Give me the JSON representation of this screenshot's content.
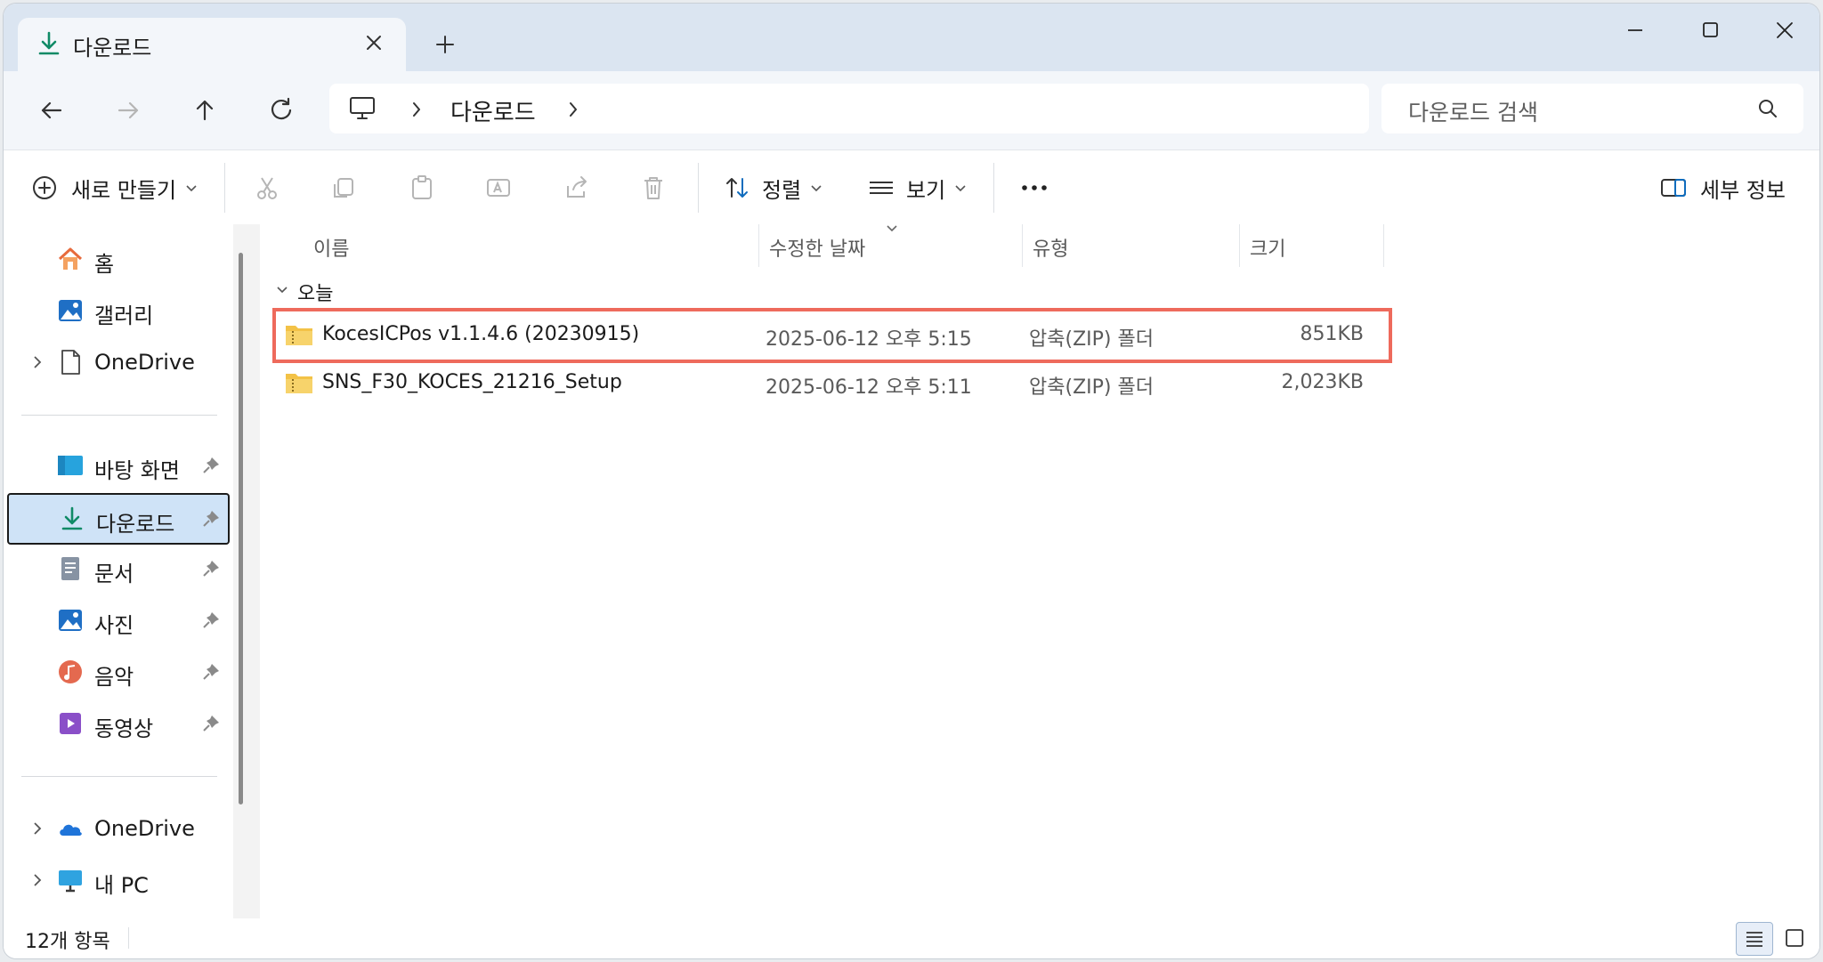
{
  "tab": {
    "title": "다운로드"
  },
  "address": {
    "segments": [
      "다운로드"
    ]
  },
  "search": {
    "placeholder": "다운로드 검색"
  },
  "command_bar": {
    "new_label": "새로 만들기",
    "sort_label": "정렬",
    "view_label": "보기",
    "details_label": "세부 정보"
  },
  "sidebar": {
    "home": "홈",
    "gallery": "갤러리",
    "onedrive_personal": "OneDrive",
    "desktop": "바탕 화면",
    "downloads": "다운로드",
    "documents": "문서",
    "pictures": "사진",
    "music": "음악",
    "videos": "동영상",
    "onedrive": "OneDrive",
    "this_pc": "내 PC"
  },
  "columns": {
    "name": "이름",
    "date": "수정한 날짜",
    "type": "유형",
    "size": "크기"
  },
  "group": {
    "label": "오늘"
  },
  "files": [
    {
      "name": "KocesICPos v1.1.4.6 (20230915)",
      "date": "2025-06-12 오후 5:15",
      "type": "압축(ZIP) 폴더",
      "size": "851KB",
      "highlighted": true
    },
    {
      "name": "SNS_F30_KOCES_21216_Setup",
      "date": "2025-06-12 오후 5:11",
      "type": "압축(ZIP) 폴더",
      "size": "2,023KB",
      "highlighted": false
    }
  ],
  "status": {
    "item_count": "12개 항목"
  },
  "colors": {
    "accent": "#0a7a5a",
    "highlight_box": "#ee6a5c",
    "selection": "#cfe3f7"
  }
}
